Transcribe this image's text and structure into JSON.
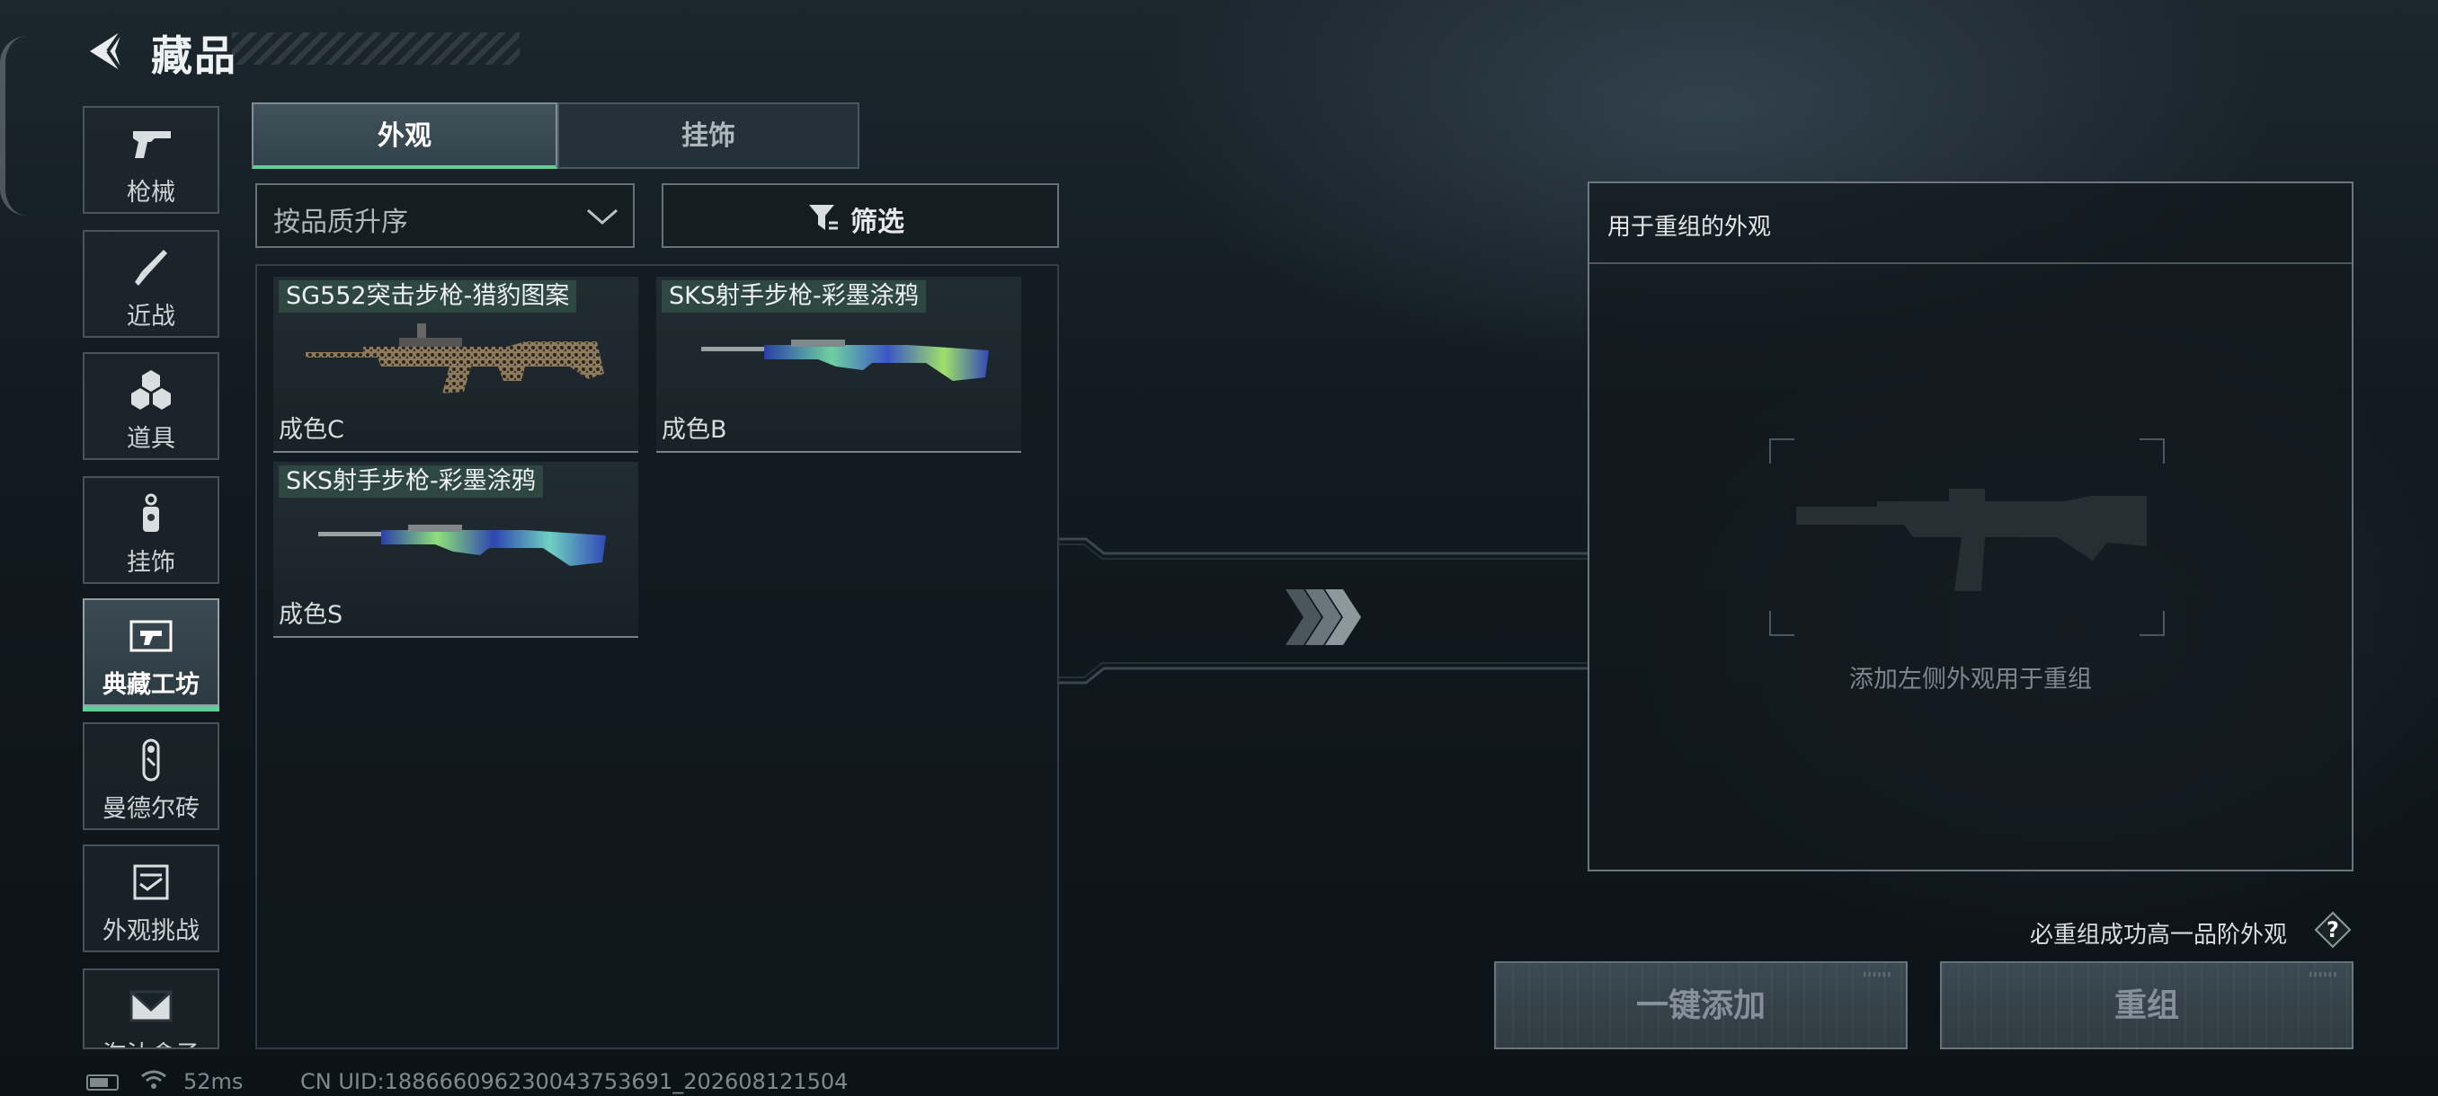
{
  "header": {
    "title": "藏品"
  },
  "sidebar": {
    "items": [
      {
        "label": "枪械",
        "icon": "pistol-icon"
      },
      {
        "label": "近战",
        "icon": "knife-icon"
      },
      {
        "label": "道具",
        "icon": "grenade-icon"
      },
      {
        "label": "挂饰",
        "icon": "charm-icon"
      },
      {
        "label": "典藏工坊",
        "icon": "workshop-icon",
        "active": true
      },
      {
        "label": "曼德尔砖",
        "icon": "key-icon"
      },
      {
        "label": "外观挑战",
        "icon": "challenge-icon"
      },
      {
        "label": "淘汰盒子",
        "icon": "box-icon"
      }
    ]
  },
  "tabs": [
    {
      "label": "外观",
      "active": true
    },
    {
      "label": "挂饰",
      "active": false
    }
  ],
  "sort": {
    "value": "按品质升序"
  },
  "filter": {
    "label": "筛选"
  },
  "items": [
    {
      "name": "SG552突击步枪-猎豹图案",
      "grade": "成色C",
      "skin": "leopard"
    },
    {
      "name": "SKS射手步枪-彩墨涂鸦",
      "grade": "成色B",
      "skin": "ink"
    },
    {
      "name": "SKS射手步枪-彩墨涂鸦",
      "grade": "成色S",
      "skin": "ink"
    }
  ],
  "panel": {
    "title": "用于重组的外观",
    "hint": "添加左侧外观用于重组"
  },
  "note": "必重组成功高一品阶外观",
  "buttons": {
    "add_all": "一键添加",
    "recombine": "重组"
  },
  "status": {
    "ping": "52ms",
    "uid": "CN UID:18866609623004375369​1_202608121504"
  },
  "colors": {
    "accent": "#5fcf97",
    "background": "#111a20"
  }
}
